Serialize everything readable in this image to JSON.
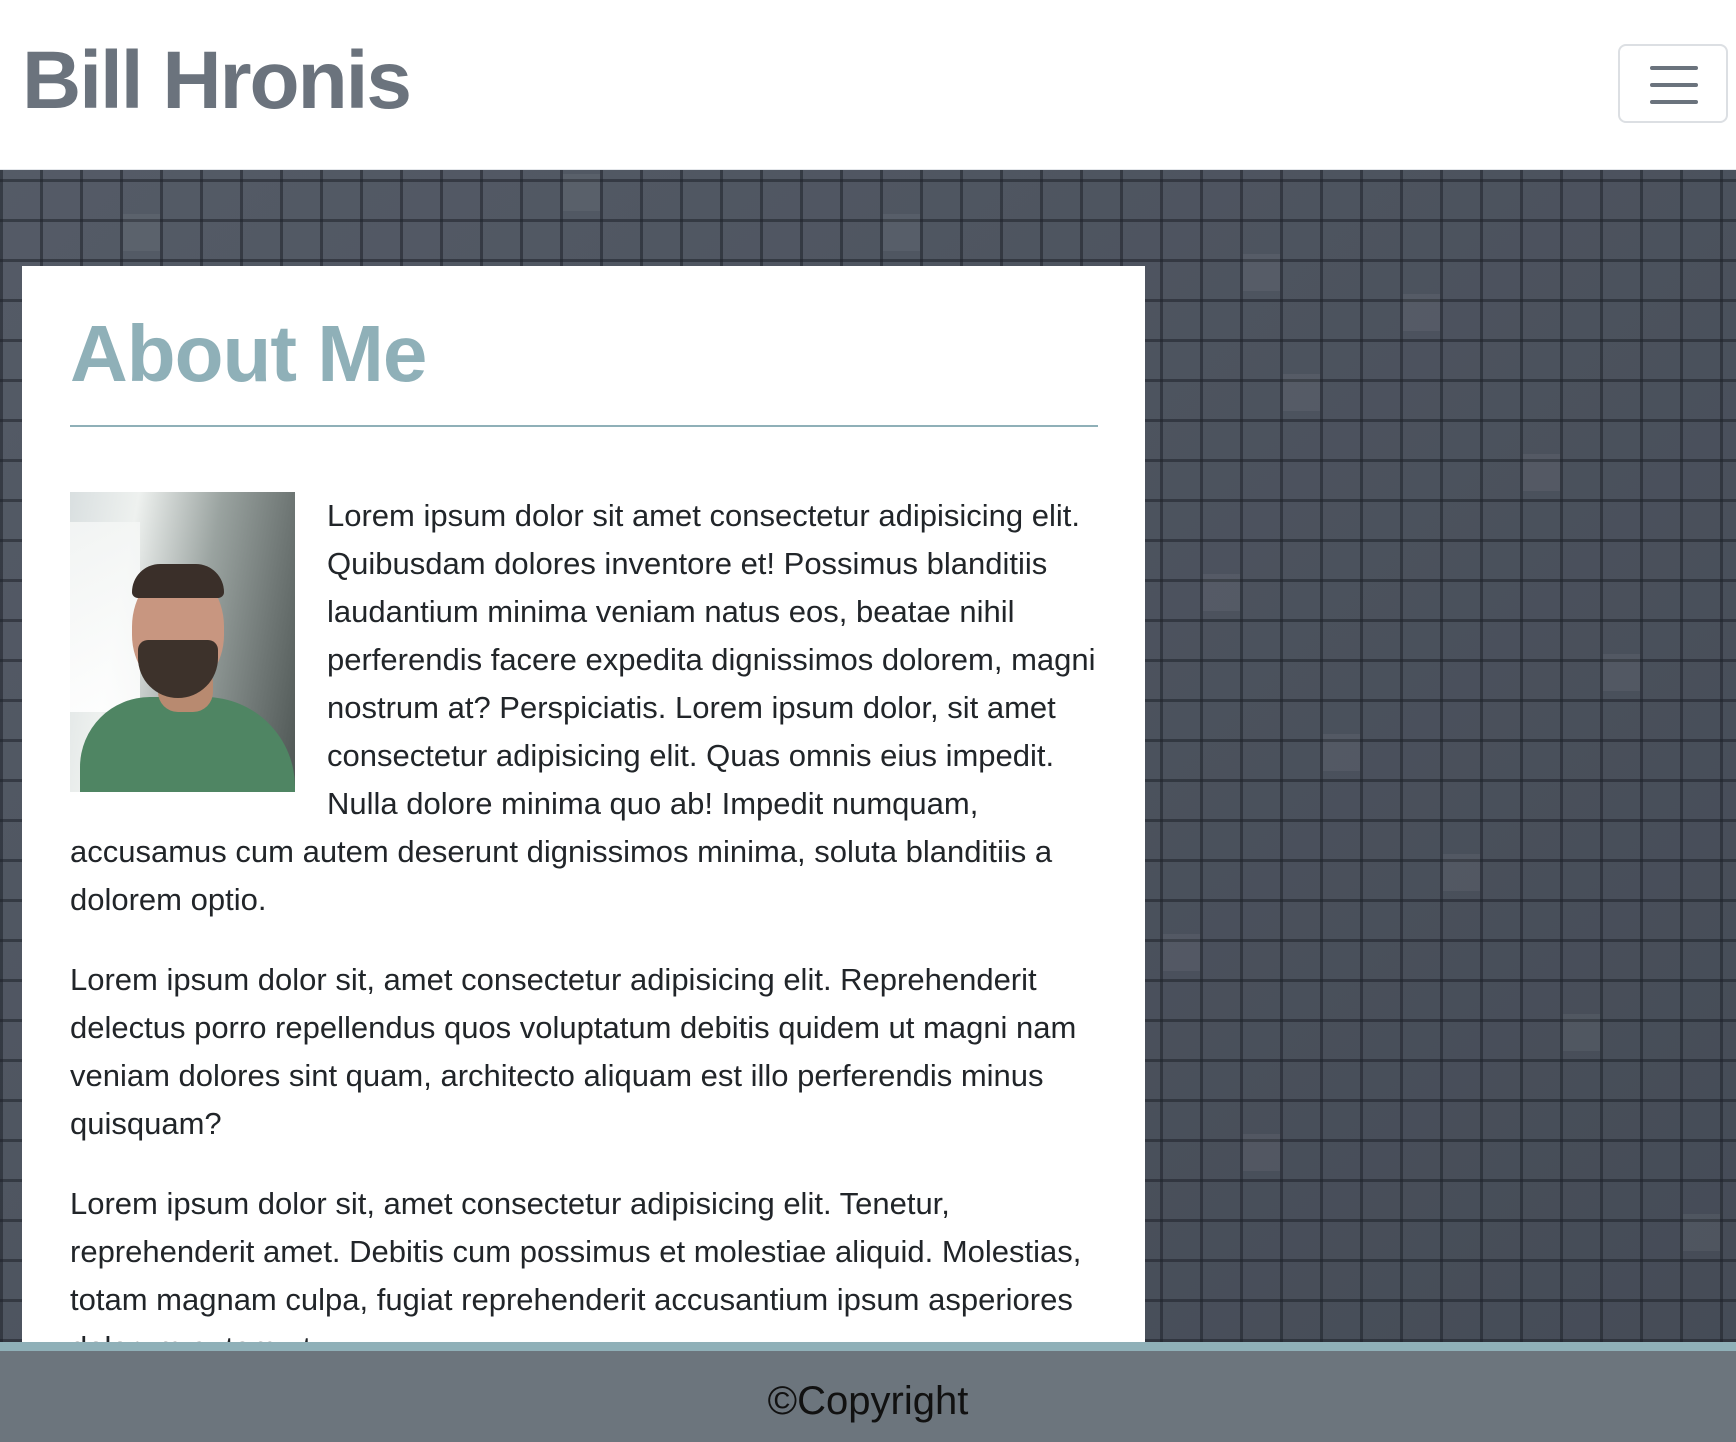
{
  "navbar": {
    "brand": "Bill Hronis",
    "toggler_icon": "menu-icon"
  },
  "about": {
    "title": "About Me",
    "photo": "profile-photo",
    "paragraphs": [
      "Lorem ipsum dolor sit amet consectetur adipisicing elit. Quibusdam dolores inventore et! Possimus blanditiis laudantium minima veniam natus eos, beatae nihil perferendis facere expedita dignissimos dolorem, magni nostrum at? Perspiciatis. Lorem ipsum dolor, sit amet consectetur adipisicing elit. Quas omnis eius impedit. Nulla dolore minima quo ab! Impedit numquam, accusamus cum autem deserunt dignissimos minima, soluta blanditiis a dolorem optio.",
      "Lorem ipsum dolor sit, amet consectetur adipisicing elit. Reprehenderit delectus porro repellendus quos voluptatum debitis quidem ut magni nam veniam dolores sint quam, architecto aliquam est illo perferendis minus quisquam?",
      "Lorem ipsum dolor sit, amet consectetur adipisicing elit. Tenetur, reprehenderit amet. Debitis cum possimus et molestiae aliquid. Molestias, totam magnam culpa, fugiat reprehenderit accusantium ipsum asperiores dolorum autem ut."
    ]
  },
  "footer": {
    "text": "©Copyright"
  },
  "colors": {
    "brand": "#6b737d",
    "heading_accent": "#8fb0b8",
    "background": "#4b525e",
    "footer": "#6c757d"
  }
}
